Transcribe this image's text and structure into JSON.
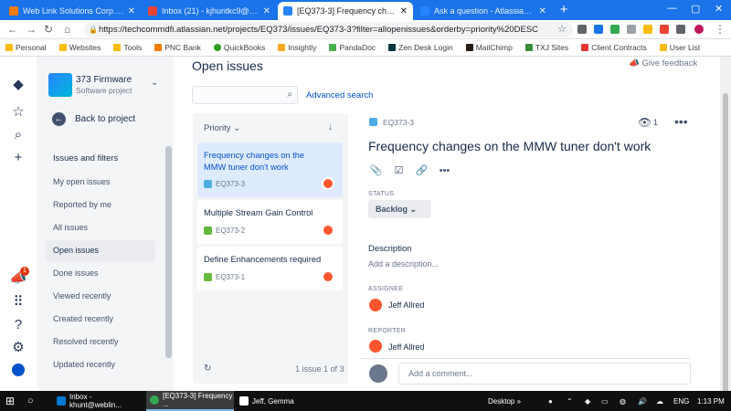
{
  "browser": {
    "tabs": [
      {
        "label": "Web Link Solutions Corp. Agent",
        "color": "#f57c00"
      },
      {
        "label": "Inbox (21) - kjhuntkc9@gmail.com",
        "color": "#ea4335"
      },
      {
        "label": "[EQ373-3] Frequency changes on",
        "color": "#2684ff"
      },
      {
        "label": "Ask a question - Atlassian Comm",
        "color": "#2684ff"
      }
    ],
    "active_tab": 2,
    "new_tab_symbol": "+",
    "url": "https://techcommdfi.atlassian.net/projects/EQ373/issues/EQ373-3?filter=allopenissues&orderby=priority%20DESC",
    "bookmarks": [
      {
        "label": "Personal",
        "color": "#fbbc04"
      },
      {
        "label": "Websites",
        "color": "#fbbc04"
      },
      {
        "label": "Tools",
        "color": "#fbbc04"
      },
      {
        "label": "PNC Bank",
        "color": "#f57c00"
      },
      {
        "label": "QuickBooks",
        "color": "#2ca01c"
      },
      {
        "label": "Insightly",
        "color": "#f9a825"
      },
      {
        "label": "PandaDoc",
        "color": "#4caf50"
      },
      {
        "label": "Zen Desk Login",
        "color": "#03363d"
      },
      {
        "label": "MailChimp",
        "color": "#241c15"
      },
      {
        "label": "TXJ Sites",
        "color": "#388e3c"
      },
      {
        "label": "Client Contracts",
        "color": "#e53935"
      },
      {
        "label": "User List",
        "color": "#fbbc04"
      }
    ]
  },
  "project": {
    "name": "373 Firmware",
    "type": "Software project",
    "back_label": "Back to project",
    "filters_heading": "Issues and filters",
    "filters": [
      "My open issues",
      "Reported by me",
      "All issues",
      "Open issues",
      "Done issues",
      "Viewed recently",
      "Created recently",
      "Resolved recently",
      "Updated recently"
    ],
    "selected_filter": 3
  },
  "notification_count": "1",
  "main": {
    "title": "Open issues",
    "feedback": "Give feedback",
    "search_placeholder": "",
    "advanced_search": "Advanced search"
  },
  "issue_list": {
    "sort_label": "Priority",
    "sort_chevron": "⌄",
    "sort_arrow": "↓",
    "items": [
      {
        "title": "Frequency changes on the MMW tuner don't work",
        "key": "EQ373-3",
        "type_color": "#4bade8"
      },
      {
        "title": "Multiple Stream Gain Control",
        "key": "EQ373-2",
        "type_color": "#63ba3c"
      },
      {
        "title": "Define Enhancements required",
        "key": "EQ373-1",
        "type_color": "#63ba3c"
      }
    ],
    "count": "1 issue 1 of 3"
  },
  "detail": {
    "key": "EQ373-3",
    "watch_count": "1",
    "title": "Frequency changes on the MMW tuner don't work",
    "status_label": "STATUS",
    "status": "Backlog",
    "description_label": "Description",
    "description_placeholder": "Add a description...",
    "assignee_label": "ASSIGNEE",
    "assignee": "Jeff Allred",
    "reporter_label": "REPORTER",
    "reporter": "Jeff Allred",
    "comment_placeholder": "Add a comment..."
  },
  "taskbar": {
    "items": [
      "Inbox - khunt@weblin...",
      "[EQ373-3] Frequency ...",
      "Jeff, Gemma"
    ],
    "desktop": "Desktop",
    "lang": "ENG",
    "time": "1:13 PM"
  }
}
